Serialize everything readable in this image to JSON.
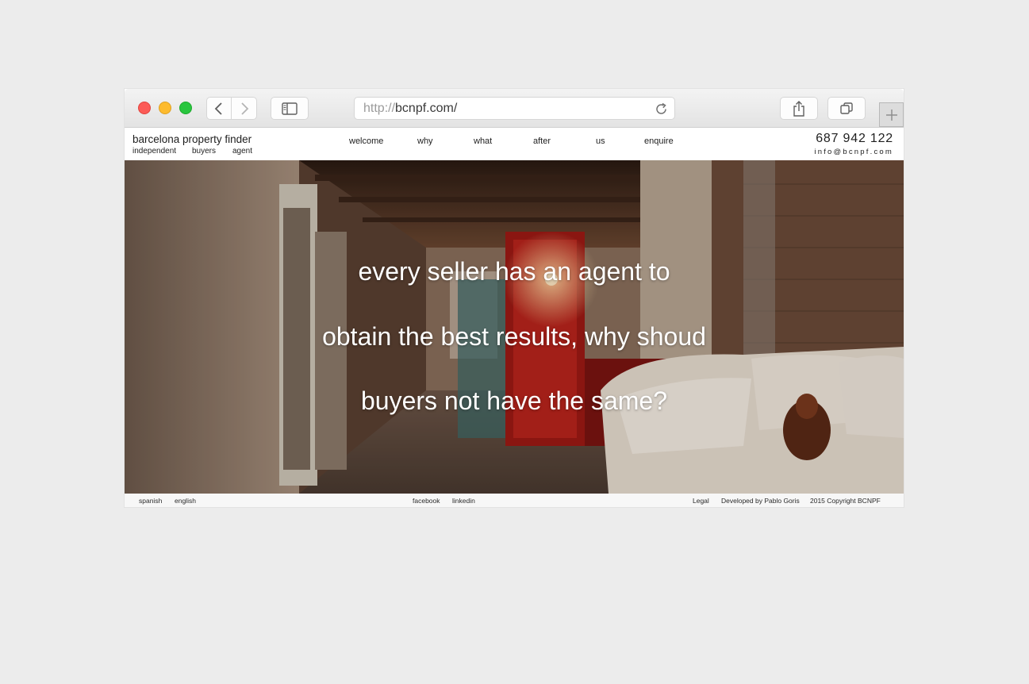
{
  "browser": {
    "url_protocol": "http://",
    "url_host": "bcnpf.com/"
  },
  "site": {
    "brand": "barcelona property finder",
    "tagline": [
      "independent",
      "buyers",
      "agent"
    ],
    "nav": [
      "welcome",
      "why",
      "what",
      "after",
      "us",
      "enquire"
    ],
    "phone": "687 942 122",
    "email": "info@bcnpf.com"
  },
  "hero": {
    "lines": [
      "every seller has an agent to",
      "obtain the best results, why shoud",
      "buyers not have the same?"
    ]
  },
  "footer": {
    "languages": [
      "spanish",
      "english"
    ],
    "social": [
      "facebook",
      "linkedin"
    ],
    "legal": "Legal",
    "developer": "Developed by Pablo Goris",
    "copyright": "2015 Copyright BCNPF"
  }
}
